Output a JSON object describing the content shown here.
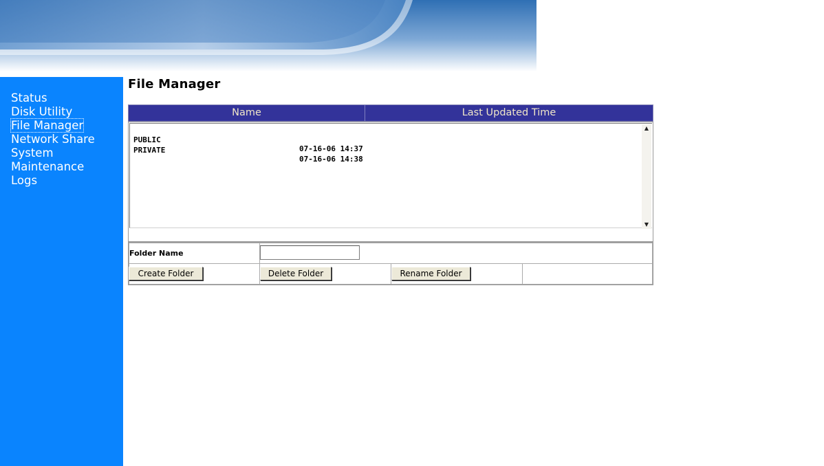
{
  "nav": {
    "items": [
      {
        "label": "Status",
        "active": false
      },
      {
        "label": "Disk Utility",
        "active": false
      },
      {
        "label": "File Manager",
        "active": true
      },
      {
        "label": "Network Share",
        "active": false
      },
      {
        "label": "System",
        "active": false
      },
      {
        "label": "Maintenance",
        "active": false
      },
      {
        "label": "Logs",
        "active": false
      }
    ]
  },
  "page": {
    "title": "File Manager"
  },
  "file_list": {
    "columns": [
      "Name",
      "Last Updated Time"
    ],
    "rows": [
      {
        "name": "PUBLIC",
        "time": "07-16-06 14:37"
      },
      {
        "name": "PRIVATE",
        "time": "07-16-06 14:38"
      }
    ]
  },
  "form": {
    "folder_label": "Folder Name",
    "folder_value": "",
    "buttons": {
      "create": "Create Folder",
      "delete": "Delete Folder",
      "rename": "Rename Folder"
    }
  },
  "colors": {
    "sidebar": "#0a84fe",
    "header": "#33339a",
    "header_text": "#f0e6c8"
  },
  "icons": {
    "scroll_up": "arrow-up-icon",
    "scroll_down": "arrow-down-icon"
  }
}
